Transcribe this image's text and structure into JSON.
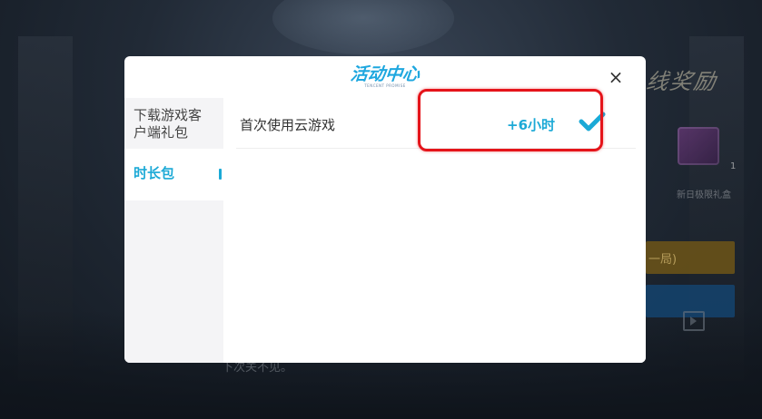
{
  "dialog": {
    "logo_text": "活动中心",
    "logo_subtext": "TENCENT PROMISE",
    "close_symbol": "×"
  },
  "sidebar": {
    "items": [
      {
        "label": "下载游戏客户端礼包",
        "active": false
      },
      {
        "label": "时长包",
        "active": true
      },
      {
        "label": "",
        "active": false
      }
    ]
  },
  "tasks": [
    {
      "label": "首次使用云游戏",
      "reward": "+6小时",
      "completed": true,
      "icon": "check-icon"
    }
  ],
  "background": {
    "title": "线奖励",
    "gift_count": "1",
    "gift_label": "新日极限礼盒",
    "gold_button_label": "一局)",
    "bottom_text": "下次关不见。"
  },
  "colors": {
    "accent": "#1ba9d6",
    "highlight": "#e5141a",
    "sidebar_bg": "#f4f4f6"
  }
}
